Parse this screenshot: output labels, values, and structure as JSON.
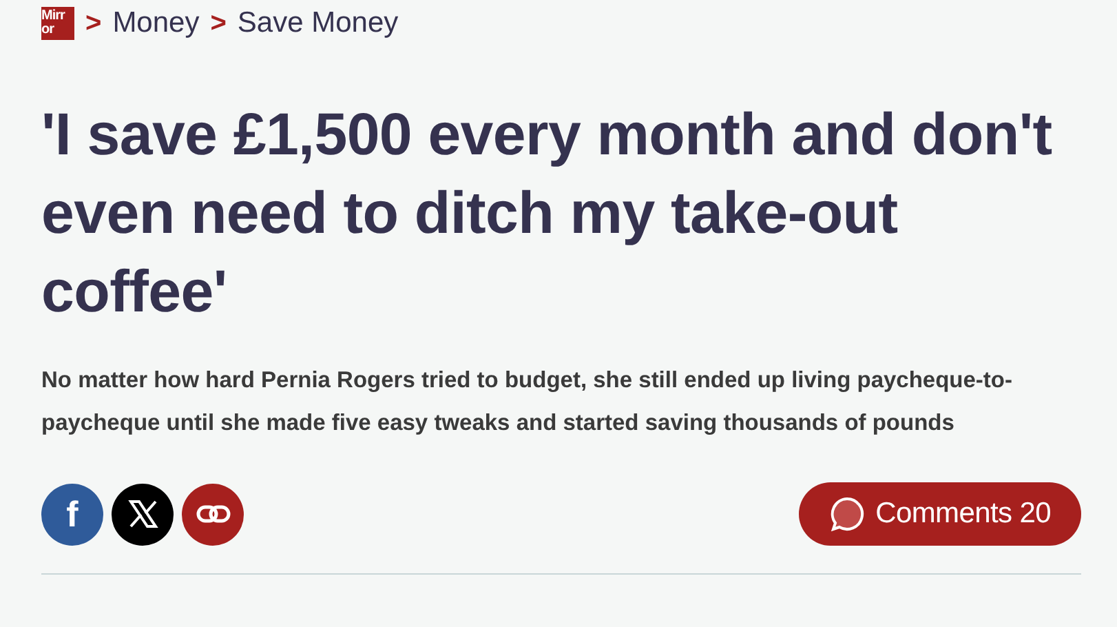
{
  "breadcrumb": {
    "logo": [
      "Mirr",
      "or"
    ],
    "separator": ">",
    "items": [
      "Money",
      "Save Money"
    ]
  },
  "headline": "'I save £1,500 every month and don't even need to ditch my take-out coffee'",
  "standfirst": "No matter how hard Pernia Rogers tried to budget, she still ended up living paycheque-to-paycheque until she made five easy tweaks and started saving thousands of pounds",
  "share": [
    {
      "kind": "facebook",
      "label": "f"
    },
    {
      "kind": "x"
    },
    {
      "kind": "link"
    }
  ],
  "comments": {
    "label": "Comments 20"
  }
}
